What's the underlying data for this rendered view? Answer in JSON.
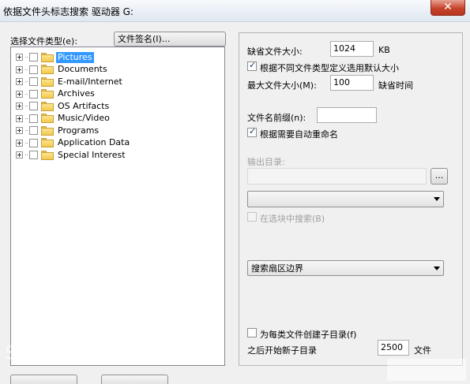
{
  "window": {
    "title": "依据文件头标志搜索 驱动器 G:",
    "close_glyph": "✕"
  },
  "left": {
    "file_type_label": "选择文件类型(e):",
    "signature_button": "文件签名(I)...",
    "tree_items": [
      {
        "label": "Pictures",
        "selected": true
      },
      {
        "label": "Documents",
        "selected": false
      },
      {
        "label": "E-mail/Internet",
        "selected": false
      },
      {
        "label": "Archives",
        "selected": false
      },
      {
        "label": "OS Artifacts",
        "selected": false
      },
      {
        "label": "Music/Video",
        "selected": false
      },
      {
        "label": "Programs",
        "selected": false
      },
      {
        "label": "Application Data",
        "selected": false
      },
      {
        "label": "Special Interest",
        "selected": false
      }
    ]
  },
  "right": {
    "default_size_label": "缺省文件大小:",
    "default_size_value": "1024",
    "default_size_unit": "KB",
    "per_type_checkbox_label": "根据不同文件类型定义选用默认大小",
    "per_type_checked": true,
    "max_size_label": "最大文件大小(M):",
    "max_size_value": "100",
    "max_size_suffix": "缺省时间",
    "prefix_label": "文件名前缀(n):",
    "prefix_value": "",
    "auto_rename_label": "根据需要自动重命名",
    "auto_rename_checked": true,
    "output_dir_label": "输出目录:",
    "output_dir_value": "",
    "browse_button": "...",
    "dropdown1_value": "",
    "search_in_block_label": "在选块中搜索(B)",
    "search_in_block_checked": false,
    "dropdown2_value": "搜索扇区边界",
    "subdir_checkbox_label": "为每类文件创建子目录(f)",
    "subdir_checked": false,
    "new_subdir_label": "之后开始新子目录",
    "new_subdir_value": "2500",
    "new_subdir_unit": "文件"
  },
  "watermark": "sfjvip",
  "colors": {
    "selection": "#3399ff",
    "close_button": "#c7432c",
    "folder": "#f3c94e"
  }
}
